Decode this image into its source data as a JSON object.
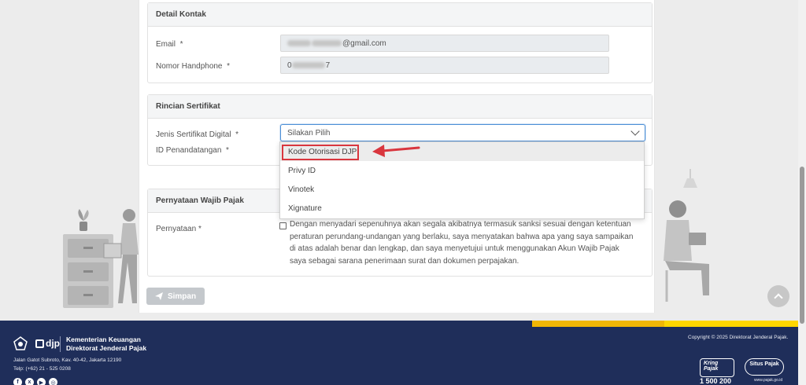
{
  "sections": {
    "contact": {
      "title": "Detail Kontak",
      "email_label": "Email",
      "email_value_visible": "@gmail.com",
      "phone_label": "Nomor Handphone",
      "phone_value_prefix": "0",
      "phone_value_suffix": "7"
    },
    "certificate": {
      "title": "Rincian Sertifikat",
      "type_label": "Jenis Sertifikat Digital",
      "type_placeholder": "Silakan Pilih",
      "signer_label": "ID Penandatangan",
      "options": [
        "Kode Otorisasi DJP",
        "Privy ID",
        "Vinotek",
        "Xignature"
      ],
      "highlighted_option": "Kode Otorisasi DJP"
    },
    "statement": {
      "title": "Pernyataan Wajib Pajak",
      "label": "Pernyataan",
      "text": "Dengan menyadari sepenuhnya akan segala akibatnya termasuk sanksi sesuai dengan ketentuan peraturan perundang-undangan yang berlaku, saya menyatakan bahwa apa yang saya sampaikan di atas adalah benar dan lengkap, dan saya menyetujui untuk menggunakan Akun Wajib Pajak saya sebagai sarana penerimaan surat dan dokumen perpajakan."
    }
  },
  "required_mark": "*",
  "save_button": "Simpan",
  "footer": {
    "logo_text": "djp",
    "org_line1": "Kementerian Keuangan",
    "org_line2": "Direktorat Jenderal Pajak",
    "address": "Jalan Gatot Subroto, Kav. 40-42, Jakarta 12190",
    "phone": "Telp: (+62) 21 - 525 0208",
    "copyright": "Copyright © 2025 Direktorat Jenderal Pajak.",
    "kring_label": "Kring Pajak",
    "kring_number": "1 500 200",
    "situs_label": "Situs Pajak",
    "situs_url": "www.pajak.go.id"
  },
  "colors": {
    "footer_bg": "#1f2e5a",
    "accent_yellow": "#f2b705",
    "highlight_red": "#d9363e",
    "select_focus": "#4d8fd6"
  }
}
